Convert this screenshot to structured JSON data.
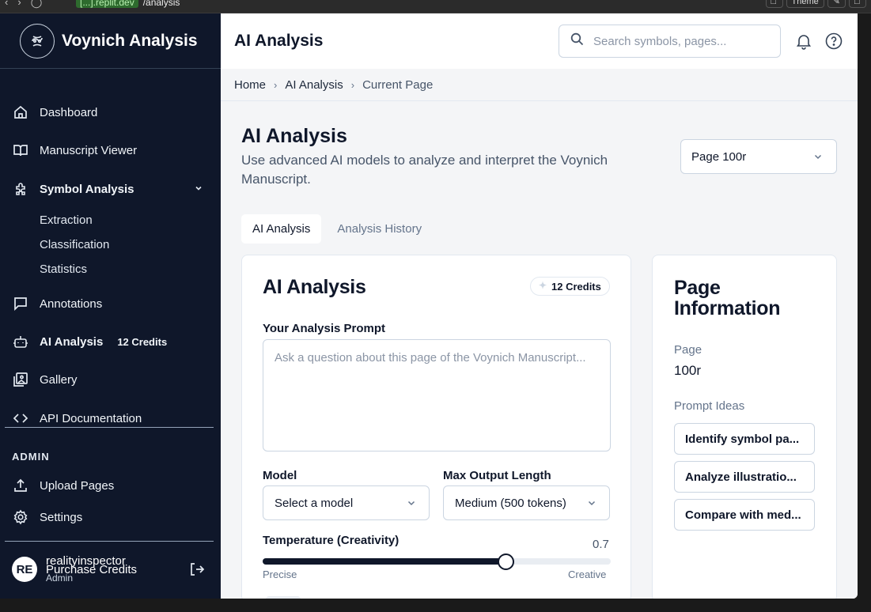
{
  "browser": {
    "url_chip": "[...].replit.dev",
    "url_path": "/analysis",
    "theme_label": "Theme"
  },
  "sidebar": {
    "brand": "Voynich Analysis",
    "items": [
      {
        "label": "Dashboard",
        "icon": "home-icon"
      },
      {
        "label": "Manuscript Viewer",
        "icon": "book-icon"
      },
      {
        "label": "Symbol Analysis",
        "icon": "puzzle-icon"
      },
      {
        "label": "Annotations",
        "icon": "message-icon"
      },
      {
        "label": "AI Analysis",
        "icon": "bot-icon",
        "badge": "12 Credits"
      },
      {
        "label": "Gallery",
        "icon": "image-icon"
      },
      {
        "label": "API Documentation",
        "icon": "code-icon"
      }
    ],
    "subitems": [
      "Extraction",
      "Classification",
      "Statistics"
    ],
    "admin_heading": "ADMIN",
    "admin_items": [
      {
        "label": "Upload Pages",
        "icon": "upload-icon"
      },
      {
        "label": "Settings",
        "icon": "gear-icon"
      }
    ],
    "user": {
      "initials": "RE",
      "name": "realityinspector",
      "purchase": "Purchase Credits",
      "role": "Admin"
    }
  },
  "header": {
    "title": "AI Analysis",
    "search_placeholder": "Search symbols, pages..."
  },
  "breadcrumb": [
    "Home",
    "AI Analysis",
    "Current Page"
  ],
  "page": {
    "title": "AI Analysis",
    "description": "Use advanced AI models to analyze and interpret the Voynich Manuscript.",
    "page_select": "Page 100r"
  },
  "tabs": [
    "AI Analysis",
    "Analysis History"
  ],
  "analysis_card": {
    "title": "AI Analysis",
    "credits": "12 Credits",
    "prompt_label": "Your Analysis Prompt",
    "prompt_placeholder": "Ask a question about this page of the Voynich Manuscript...",
    "model_label": "Model",
    "model_value": "Select a model",
    "max_label": "Max Output Length",
    "max_value": "Medium (500 tokens)",
    "temp_label": "Temperature (Creativity)",
    "temp_value": "0.7",
    "temp_fraction": 0.7,
    "temp_min_label": "Precise",
    "temp_max_label": "Creative"
  },
  "info_card": {
    "title": "Page Information",
    "page_label": "Page",
    "page_value": "100r",
    "ideas_label": "Prompt Ideas",
    "ideas": [
      "Identify symbol pa...",
      "Analyze illustratio...",
      "Compare with med..."
    ]
  },
  "colors": {
    "sidebar_bg": "#0f172a",
    "main_bg": "#f4f5f7",
    "accent": "#0f172a"
  }
}
